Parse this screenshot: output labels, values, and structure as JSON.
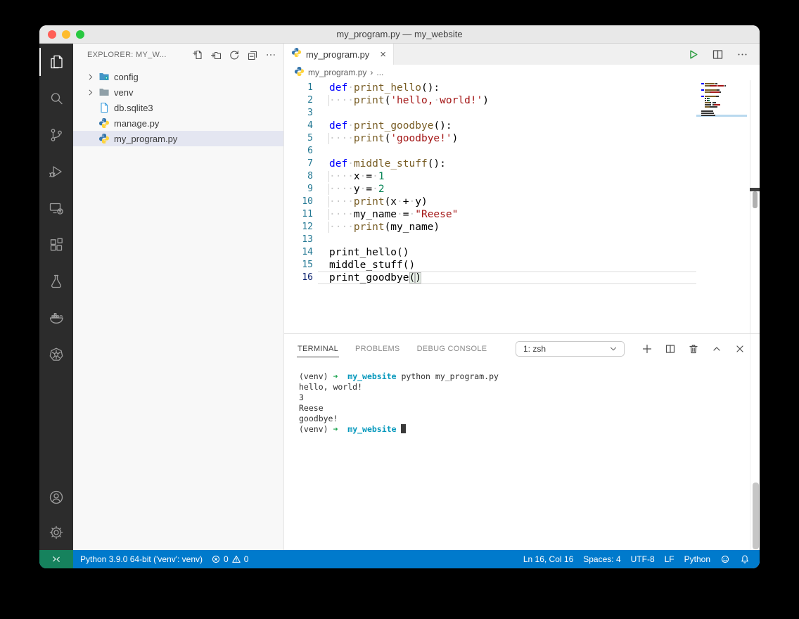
{
  "window": {
    "title": "my_program.py — my_website"
  },
  "activity_bar": {
    "items": [
      {
        "name": "explorer",
        "active": true
      },
      {
        "name": "search",
        "active": false
      },
      {
        "name": "source-control",
        "active": false
      },
      {
        "name": "run-and-debug",
        "active": false
      },
      {
        "name": "remote-explorer",
        "active": false
      },
      {
        "name": "extensions",
        "active": false
      },
      {
        "name": "testing",
        "active": false
      },
      {
        "name": "docker",
        "active": false
      },
      {
        "name": "kubernetes",
        "active": false
      }
    ],
    "bottom_items": [
      {
        "name": "accounts"
      },
      {
        "name": "settings"
      }
    ]
  },
  "sidebar": {
    "header": {
      "title": "EXPLORER: MY_W...",
      "action_icons": [
        "new-file-icon",
        "new-folder-icon",
        "refresh-icon",
        "collapse-all-icon",
        "more-actions-icon"
      ]
    },
    "files": [
      {
        "label": "config",
        "icon": "folder-config",
        "expandable": true,
        "selected": false
      },
      {
        "label": "venv",
        "icon": "folder",
        "expandable": true,
        "selected": false
      },
      {
        "label": "db.sqlite3",
        "icon": "file",
        "expandable": false,
        "selected": false
      },
      {
        "label": "manage.py",
        "icon": "python",
        "expandable": false,
        "selected": false
      },
      {
        "label": "my_program.py",
        "icon": "python",
        "expandable": false,
        "selected": true
      }
    ]
  },
  "editor": {
    "tab": {
      "label": "my_program.py",
      "icon": "python-icon",
      "close_glyph": "×"
    },
    "action_icons": [
      "run-icon",
      "split-editor-icon",
      "more-actions-icon"
    ],
    "breadcrumb": {
      "file": "my_program.py",
      "separator": "›",
      "more": "..."
    },
    "code": {
      "current_line": 16,
      "lines": [
        {
          "num": 1,
          "tokens": [
            [
              "kw",
              "def"
            ],
            [
              "ws",
              "·"
            ],
            [
              "fn",
              "print_hello"
            ],
            [
              "pl",
              "():"
            ]
          ]
        },
        {
          "num": 2,
          "tokens": [
            [
              "wsg",
              "····"
            ],
            [
              "fn",
              "print"
            ],
            [
              "pl",
              "("
            ],
            [
              "str",
              "'hello,"
            ],
            [
              "ws",
              "·"
            ],
            [
              "str",
              "world!'"
            ],
            [
              "pl",
              ")"
            ]
          ]
        },
        {
          "num": 3,
          "tokens": []
        },
        {
          "num": 4,
          "tokens": [
            [
              "kw",
              "def"
            ],
            [
              "ws",
              "·"
            ],
            [
              "fn",
              "print_goodbye"
            ],
            [
              "pl",
              "():"
            ]
          ]
        },
        {
          "num": 5,
          "tokens": [
            [
              "wsg",
              "····"
            ],
            [
              "fn",
              "print"
            ],
            [
              "pl",
              "("
            ],
            [
              "str",
              "'goodbye!'"
            ],
            [
              "pl",
              ")"
            ]
          ]
        },
        {
          "num": 6,
          "tokens": []
        },
        {
          "num": 7,
          "tokens": [
            [
              "kw",
              "def"
            ],
            [
              "ws",
              "·"
            ],
            [
              "fn",
              "middle_stuff"
            ],
            [
              "pl",
              "():"
            ]
          ]
        },
        {
          "num": 8,
          "tokens": [
            [
              "wsg",
              "····"
            ],
            [
              "pl",
              "x"
            ],
            [
              "ws",
              "·"
            ],
            [
              "pl",
              "="
            ],
            [
              "ws",
              "·"
            ],
            [
              "num",
              "1"
            ]
          ]
        },
        {
          "num": 9,
          "tokens": [
            [
              "wsg",
              "····"
            ],
            [
              "pl",
              "y"
            ],
            [
              "ws",
              "·"
            ],
            [
              "pl",
              "="
            ],
            [
              "ws",
              "·"
            ],
            [
              "num",
              "2"
            ]
          ]
        },
        {
          "num": 10,
          "tokens": [
            [
              "wsg",
              "····"
            ],
            [
              "fn",
              "print"
            ],
            [
              "pl",
              "(x"
            ],
            [
              "ws",
              "·"
            ],
            [
              "pl",
              "+"
            ],
            [
              "ws",
              "·"
            ],
            [
              "pl",
              "y)"
            ]
          ]
        },
        {
          "num": 11,
          "tokens": [
            [
              "wsg",
              "····"
            ],
            [
              "pl",
              "my_name"
            ],
            [
              "ws",
              "·"
            ],
            [
              "pl",
              "="
            ],
            [
              "ws",
              "·"
            ],
            [
              "str",
              "\"Reese\""
            ]
          ]
        },
        {
          "num": 12,
          "tokens": [
            [
              "wsg",
              "····"
            ],
            [
              "fn",
              "print"
            ],
            [
              "pl",
              "(my_name)"
            ]
          ]
        },
        {
          "num": 13,
          "tokens": []
        },
        {
          "num": 14,
          "tokens": [
            [
              "pl",
              "print_hello()"
            ]
          ]
        },
        {
          "num": 15,
          "tokens": [
            [
              "pl",
              "middle_stuff()"
            ]
          ]
        },
        {
          "num": 16,
          "tokens": [
            [
              "pl",
              "print_goodbye"
            ],
            [
              "bm",
              "("
            ],
            [
              "bm",
              ")"
            ]
          ]
        }
      ]
    }
  },
  "panel": {
    "tabs": [
      {
        "label": "TERMINAL",
        "active": true
      },
      {
        "label": "PROBLEMS",
        "active": false
      },
      {
        "label": "DEBUG CONSOLE",
        "active": false
      }
    ],
    "shell_select": {
      "value": "1: zsh"
    },
    "action_icons": [
      "new-terminal-icon",
      "split-terminal-icon",
      "kill-terminal-icon",
      "maximize-panel-icon",
      "close-panel-icon"
    ],
    "terminal_lines": [
      {
        "tokens": [
          [
            "pl",
            "(venv) "
          ],
          [
            "arr",
            "➜"
          ],
          [
            "pl",
            "  "
          ],
          [
            "dir",
            "my_website"
          ],
          [
            "pl",
            " python my_program.py"
          ]
        ]
      },
      {
        "tokens": [
          [
            "pl",
            "hello, world!"
          ]
        ]
      },
      {
        "tokens": [
          [
            "pl",
            "3"
          ]
        ]
      },
      {
        "tokens": [
          [
            "pl",
            "Reese"
          ]
        ]
      },
      {
        "tokens": [
          [
            "pl",
            "goodbye!"
          ]
        ]
      },
      {
        "tokens": [
          [
            "pl",
            "(venv) "
          ],
          [
            "arr",
            "➜"
          ],
          [
            "pl",
            "  "
          ],
          [
            "dir",
            "my_website"
          ],
          [
            "pl",
            " "
          ],
          [
            "cur",
            "█"
          ]
        ]
      }
    ]
  },
  "status_bar": {
    "python_version": "Python 3.9.0 64-bit ('venv': venv)",
    "errors": "0",
    "warnings": "0",
    "right_items": [
      "Ln 16, Col 16",
      "Spaces: 4",
      "UTF-8",
      "LF",
      "Python"
    ]
  },
  "colors": {
    "status_bg": "#007acc",
    "remote_bg": "#16825d",
    "run_green": "#2f9e44",
    "keyword": "#0000ff",
    "function": "#795e26",
    "string": "#a31515",
    "number": "#098658",
    "line_number": "#237893",
    "selected_file_bg": "#e4e6f1",
    "terminal_dir": "#0598bc",
    "terminal_arrow": "#16a24b"
  }
}
